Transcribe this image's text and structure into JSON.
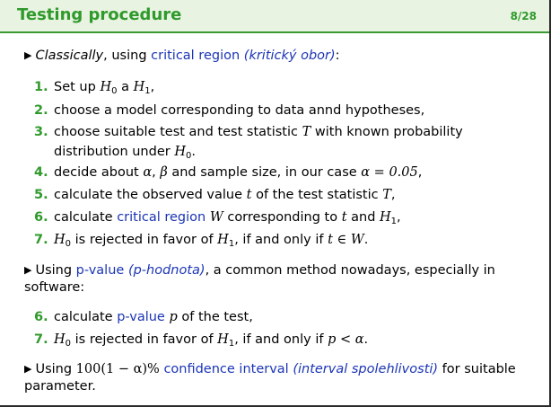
{
  "slide": {
    "title": "Testing procedure",
    "page": "8/28"
  },
  "bullet1": {
    "lead": "Classically",
    "text1": ", using ",
    "term": "critical region",
    "term_cz": "(kritický obor)",
    "tail": ":"
  },
  "steps": {
    "s1": {
      "num": "1.",
      "a": "Set up ",
      "H0": "H",
      "mid": " a ",
      "H1": "H"
    },
    "s2": {
      "num": "2.",
      "text": "choose a model corresponding to data annd hypotheses,"
    },
    "s3": {
      "num": "3.",
      "line1a": "choose suitable test and test statistic ",
      "T": "T",
      "line1b": " with known probability",
      "line2": "distribution under ",
      "H0": "H",
      "end": "."
    },
    "s4": {
      "num": "4.",
      "a": "decide about ",
      "alpha": "α",
      "comma": ", ",
      "beta": "β",
      "b": " and sample size, in our case ",
      "eq": "α = 0.05",
      "end": ","
    },
    "s5": {
      "num": "5.",
      "a": "calculate the observed value ",
      "t": "t",
      "b": " of the test statistic ",
      "T": "T",
      "end": ","
    },
    "s6": {
      "num": "6.",
      "a": "calculate ",
      "term": "critical region",
      "W": " W",
      "b": " corresponding to ",
      "t": "t",
      "c": " and ",
      "H1": "H",
      "end": ","
    },
    "s7": {
      "num": "7.",
      "H0": "H",
      "a": " is rejected in favor of ",
      "H1": "H",
      "b": ", if and only if ",
      "expr": "t ∈ W",
      "end": "."
    }
  },
  "bullet2": {
    "a": "Using ",
    "term": "p-value",
    "term_cz": "(p-hodnota)",
    "line1b": ", a common method nowadays, especially in",
    "line2": "software:"
  },
  "pvsteps": {
    "s6": {
      "num": "6.",
      "a": "calculate ",
      "term": "p-value",
      "p": " p",
      "b": " of the test,"
    },
    "s7": {
      "num": "7.",
      "H0": "H",
      "a": " is rejected in favor of ",
      "H1": "H",
      "b": ", if and only if ",
      "expr": "p < α",
      "end": "."
    }
  },
  "bullet3": {
    "a": "Using ",
    "expr": "100(1 − α)%",
    "term": "confidence interval",
    "term_cz": "(interval spolehlivosti)",
    "b": " for suitable",
    "line2": "parameter."
  },
  "subscripts": {
    "zero": "0",
    "one": "1"
  },
  "colors": {
    "accent_green": "#2f9a2b",
    "link_blue": "#1b35b5",
    "header_bg": "#e9f3e2"
  }
}
